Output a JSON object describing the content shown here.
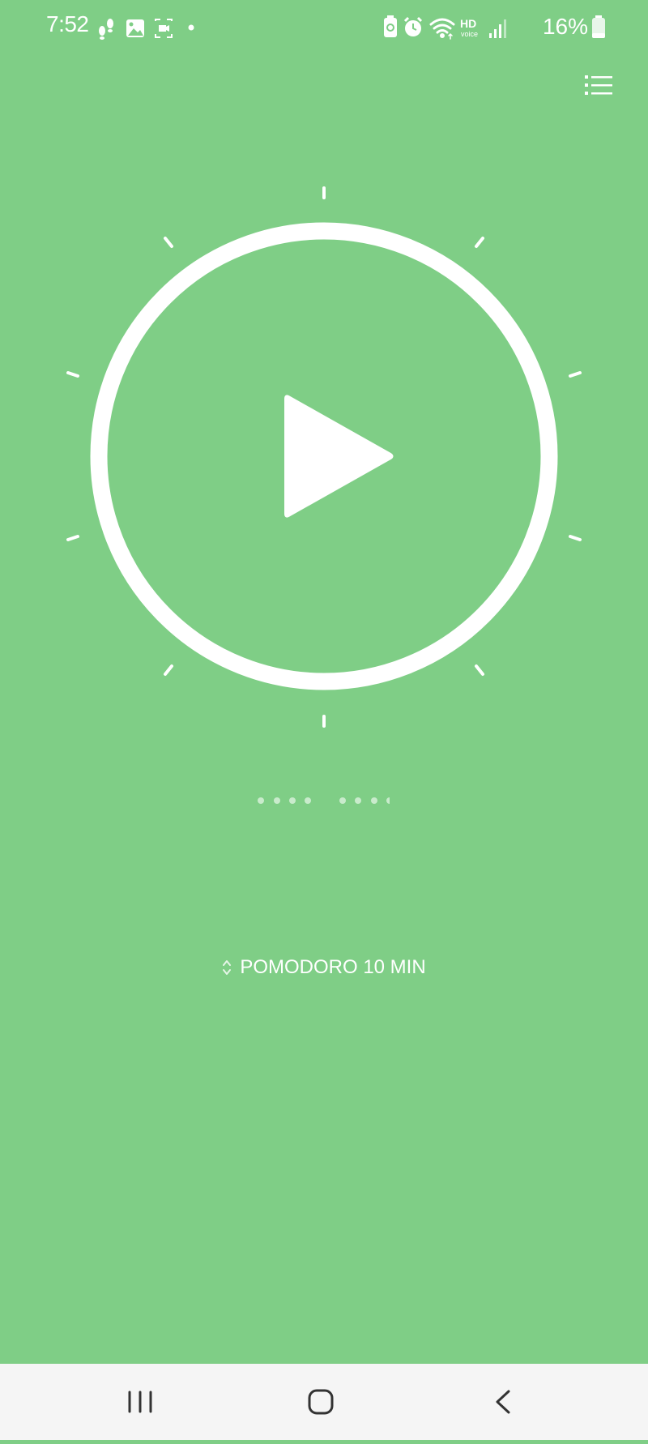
{
  "status_bar": {
    "time": "7:52",
    "battery_percent": "16%",
    "hd_label": "HD",
    "voice_label": "voice"
  },
  "header": {
    "menu_icon": "list-menu-icon"
  },
  "timer": {
    "control_icon": "play-icon",
    "progress_dots_count": 8
  },
  "preset": {
    "label": "POMODORO 10 MIN",
    "icon": "up-down-chevron-icon"
  },
  "colors": {
    "background": "#7FCE86",
    "foreground": "#FFFFFF",
    "nav_bar": "#F5F5F5",
    "nav_icon": "#333333"
  }
}
